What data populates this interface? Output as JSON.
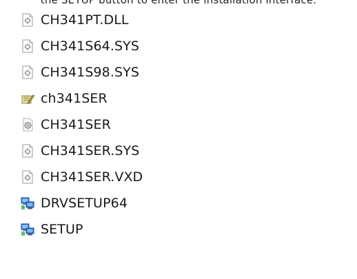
{
  "caption": "the SETUP button to enter the installation interface.",
  "files": [
    {
      "name": "CH341PT.DLL",
      "icon": "settings-file-icon"
    },
    {
      "name": "CH341S64.SYS",
      "icon": "settings-file-icon"
    },
    {
      "name": "CH341S98.SYS",
      "icon": "settings-file-icon"
    },
    {
      "name": "ch341SER",
      "icon": "setup-information-icon"
    },
    {
      "name": "CH341SER",
      "icon": "config-file-icon"
    },
    {
      "name": "CH341SER.SYS",
      "icon": "settings-file-icon"
    },
    {
      "name": "CH341SER.VXD",
      "icon": "settings-file-icon"
    },
    {
      "name": "DRVSETUP64",
      "icon": "installer-computer-icon"
    },
    {
      "name": "SETUP",
      "icon": "installer-computer-icon"
    }
  ]
}
